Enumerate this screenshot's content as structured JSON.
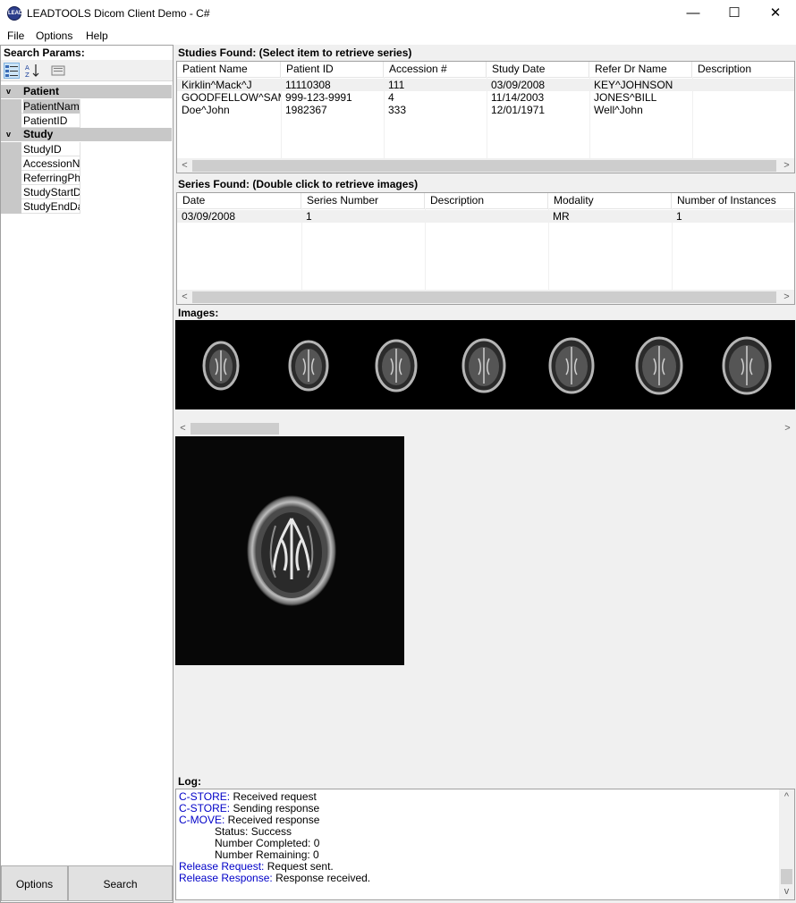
{
  "window": {
    "title": "LEADTOOLS Dicom Client Demo - C#",
    "icon_text": "LEAD",
    "minimize_glyph": "—",
    "maximize_glyph": "☐",
    "close_glyph": "✕"
  },
  "menu": {
    "file": "File",
    "options": "Options",
    "help": "Help"
  },
  "search_panel": {
    "header": "Search Params:",
    "toolbar": {
      "categorized_glyph": "▤",
      "alphabetical_glyph": "A↓Z",
      "pages_glyph": "▭"
    },
    "categories": [
      {
        "label": "Patient",
        "arrow": "v",
        "props": [
          "PatientName",
          "PatientID"
        ]
      },
      {
        "label": "Study",
        "arrow": "v",
        "props": [
          "StudyID",
          "AccessionN",
          "ReferringPhy",
          "StudyStartDa",
          "StudyEndDa"
        ]
      }
    ],
    "options_button": "Options",
    "search_button": "Search"
  },
  "studies": {
    "label": "Studies Found: (Select item to retrieve series)",
    "columns": [
      "Patient Name",
      "Patient ID",
      "Accession #",
      "Study Date",
      "Refer Dr Name",
      "Description"
    ],
    "rows": [
      [
        "Kirklin^Mack^J",
        "11110308",
        "111",
        "03/09/2008",
        "KEY^JOHNSON",
        ""
      ],
      [
        "GOODFELLOW^SAM",
        "999-123-9991",
        "4",
        "11/14/2003",
        "JONES^BILL",
        ""
      ],
      [
        "Doe^John",
        "1982367",
        "333",
        "12/01/1971",
        "Well^John",
        ""
      ]
    ]
  },
  "series": {
    "label": "Series Found: (Double click to retrieve images)",
    "columns": [
      "Date",
      "Series Number",
      "Description",
      "Modality",
      "Number of Instances"
    ],
    "rows": [
      [
        "03/09/2008",
        "1",
        "",
        "MR",
        "1"
      ]
    ]
  },
  "scroll": {
    "left": "<",
    "right": ">",
    "up": "^",
    "down": "v"
  },
  "images": {
    "label": "Images:",
    "thumbnail_count": 7
  },
  "log": {
    "label": "Log:",
    "lines": [
      {
        "key": "C-STORE:",
        "text": " Received request",
        "indent": ""
      },
      {
        "key": "C-STORE:",
        "text": " Sending response",
        "indent": ""
      },
      {
        "key": "C-MOVE:",
        "text": " Received response",
        "indent": ""
      },
      {
        "key": "",
        "text": "Status: Success",
        "indent": "            "
      },
      {
        "key": "",
        "text": "Number Completed: 0",
        "indent": "            "
      },
      {
        "key": "",
        "text": "Number Remaining: 0",
        "indent": "            "
      },
      {
        "key": "Release Request:",
        "text": " Request sent.",
        "indent": ""
      },
      {
        "key": "Release Response:",
        "text": " Response received.",
        "indent": ""
      }
    ]
  }
}
